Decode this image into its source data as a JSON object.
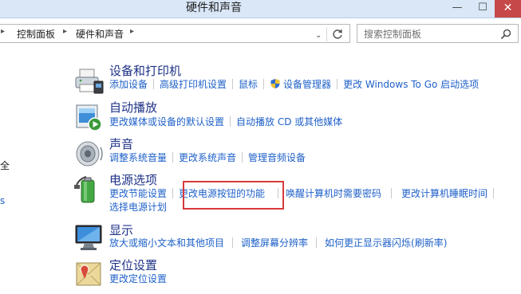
{
  "window": {
    "title": "硬件和声音",
    "min_glyph": "—",
    "max_glyph": "☐",
    "close_glyph": "✕"
  },
  "address": {
    "crumbs": [
      "控制面板",
      "硬件和声音"
    ],
    "dropdown_glyph": "⌄",
    "search_placeholder": "搜索控制面板"
  },
  "sidebar_fragments": [
    "全",
    "s"
  ],
  "categories": [
    {
      "title": "设备和打印机",
      "icon": "printer-icon",
      "links": [
        "添加设备",
        "高级打印机设置",
        "鼠标",
        "设备管理器",
        "更改 Windows To Go 启动选项"
      ]
    },
    {
      "title": "自动播放",
      "icon": "autoplay-icon",
      "links": [
        "更改媒体或设备的默认设置",
        "自动播放 CD 或其他媒体"
      ]
    },
    {
      "title": "声音",
      "icon": "speaker-icon",
      "links": [
        "调整系统音量",
        "更改系统声音",
        "管理音频设备"
      ]
    },
    {
      "title": "电源选项",
      "icon": "battery-icon",
      "links": [
        "更改节能设置",
        "更改电源按钮的功能",
        "唤醒计算机时需要密码",
        "更改计算机睡眠时间",
        "选择电源计划"
      ]
    },
    {
      "title": "显示",
      "icon": "monitor-icon",
      "links": [
        "放大或缩小文本和其他项目",
        "调整屏幕分辨率",
        "如何更正显示器闪烁(刷新率)"
      ]
    },
    {
      "title": "定位设置",
      "icon": "location-icon",
      "links": [
        "更改定位设置"
      ]
    }
  ],
  "colors": {
    "link": "#1e60c8",
    "title": "#1e3287",
    "highlight": "#d8393a",
    "titlebar": "#d9e7f7"
  }
}
